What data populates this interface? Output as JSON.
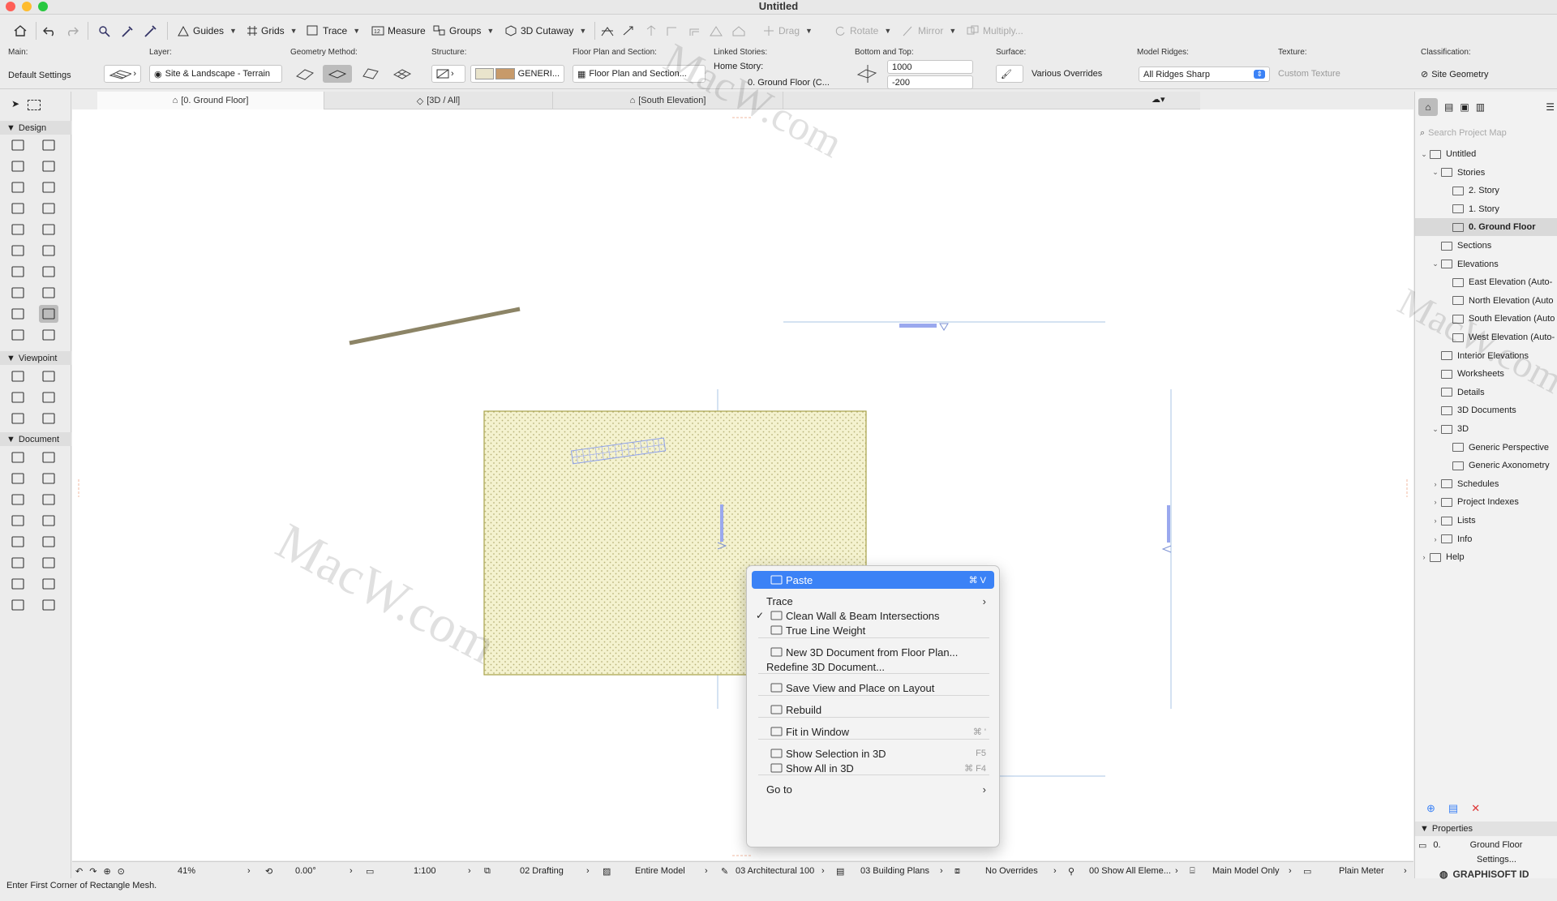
{
  "window": {
    "title": "Untitled"
  },
  "toolbar": {
    "guides": "Guides",
    "grids": "Grids",
    "trace": "Trace",
    "measure": "Measure",
    "groups": "Groups",
    "cutaway": "3D Cutaway",
    "drag": "Drag",
    "rotate": "Rotate",
    "mirror": "Mirror",
    "multiply": "Multiply..."
  },
  "infobox": {
    "main_label": "Main:",
    "default_settings": "Default Settings",
    "layer_label": "Layer:",
    "layer_value": "Site & Landscape - Terrain",
    "geometry_label": "Geometry Method:",
    "structure_label": "Structure:",
    "structure_value": "GENERI...",
    "floorplan_label": "Floor Plan and Section:",
    "floorplan_value": "Floor Plan and Section...",
    "linked_label": "Linked Stories:",
    "home_story_label": "Home Story:",
    "home_story_value": "0. Ground Floor (C...",
    "bottom_top_label": "Bottom and Top:",
    "top_value": "1000",
    "bottom_value": "-200",
    "surface_label": "Surface:",
    "surface_value": "Various Overrides",
    "ridges_label": "Model Ridges:",
    "ridges_value": "All Ridges Sharp",
    "texture_label": "Texture:",
    "texture_value": "Custom Texture",
    "classification_label": "Classification:",
    "classification_value": "Site Geometry"
  },
  "tabs": [
    {
      "label": "[0. Ground Floor]"
    },
    {
      "label": "[3D / All]"
    },
    {
      "label": "[South Elevation]"
    }
  ],
  "toolbox": {
    "design": "Design",
    "viewpoint": "Viewpoint",
    "document": "Document"
  },
  "navigator": {
    "search_placeholder": "Search Project Map",
    "items": [
      {
        "label": "Untitled"
      },
      {
        "label": "Stories"
      },
      {
        "label": "2. Story"
      },
      {
        "label": "1. Story"
      },
      {
        "label": "0. Ground Floor"
      },
      {
        "label": "Sections"
      },
      {
        "label": "Elevations"
      },
      {
        "label": "East Elevation (Auto-"
      },
      {
        "label": "North Elevation (Auto"
      },
      {
        "label": "South Elevation (Auto"
      },
      {
        "label": "West Elevation (Auto-"
      },
      {
        "label": "Interior Elevations"
      },
      {
        "label": "Worksheets"
      },
      {
        "label": "Details"
      },
      {
        "label": "3D Documents"
      },
      {
        "label": "3D"
      },
      {
        "label": "Generic Perspective"
      },
      {
        "label": "Generic Axonometry"
      },
      {
        "label": "Schedules"
      },
      {
        "label": "Project Indexes"
      },
      {
        "label": "Lists"
      },
      {
        "label": "Info"
      },
      {
        "label": "Help"
      }
    ],
    "properties_label": "Properties",
    "prop_num": "0.",
    "prop_name": "Ground Floor",
    "settings": "Settings...",
    "brand": "GRAPHISOFT ID"
  },
  "context_menu": [
    {
      "label": "Paste",
      "shortcut": "⌘ V",
      "icon": "paste-icon"
    },
    {
      "label": "Trace",
      "submenu": true
    },
    {
      "label": "Clean Wall & Beam Intersections",
      "checked": true,
      "icon": "intersect-icon"
    },
    {
      "label": "True Line Weight",
      "icon": "lineweight-icon"
    },
    {
      "label": "New 3D Document from Floor Plan...",
      "icon": "3d-doc-icon"
    },
    {
      "label": "Redefine 3D Document..."
    },
    {
      "label": "Save View and Place on Layout",
      "icon": "layout-icon"
    },
    {
      "label": "Rebuild",
      "icon": "rebuild-icon"
    },
    {
      "label": "Fit in Window",
      "shortcut": "⌘ '",
      "icon": "zoom-fit-icon"
    },
    {
      "label": "Show Selection in 3D",
      "shortcut": "F5",
      "icon": "cube-icon"
    },
    {
      "label": "Show All in 3D",
      "shortcut": "⌘ F4",
      "icon": "cube-all-icon"
    },
    {
      "label": "Go to",
      "submenu": true
    }
  ],
  "statusbar": {
    "zoom": "41%",
    "angle": "0.00°",
    "scale": "1:100",
    "layer_combo": "02 Drafting",
    "model": "Entire Model",
    "pen_set": "03 Architectural 100",
    "mvo": "03 Building Plans",
    "overrides": "No Overrides",
    "renovation": "00 Show All Eleme...",
    "structure": "Main Model Only",
    "dimension": "Plain Meter"
  },
  "hint": "Enter First Corner of Rectangle Mesh.",
  "watermark": "MacW.com",
  "colors": {
    "accent": "#3b82f6",
    "mesh_fill": "#f2f0c8",
    "mesh_border": "#a8a24a"
  }
}
